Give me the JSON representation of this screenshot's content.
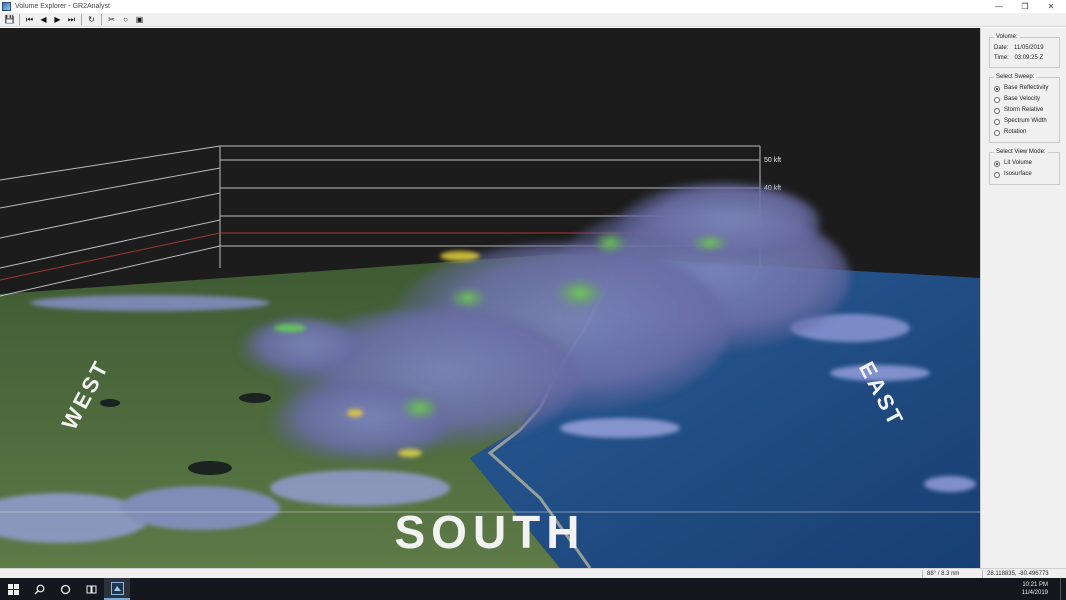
{
  "window": {
    "title": "Volume Explorer - GR2Analyst",
    "controls": {
      "minimize": "—",
      "restore": "❐",
      "close": "✕"
    }
  },
  "toolbar": {
    "buttons": [
      {
        "name": "save-icon",
        "glyph": "💾"
      },
      {
        "name": "first-frame-icon",
        "glyph": "⏮"
      },
      {
        "name": "prev-frame-icon",
        "glyph": "◀"
      },
      {
        "name": "play-icon",
        "glyph": "▶"
      },
      {
        "name": "last-frame-icon",
        "glyph": "⏭"
      },
      {
        "name": "refresh-icon",
        "glyph": "↻"
      },
      {
        "name": "cut-icon",
        "glyph": "✂"
      },
      {
        "name": "circle-icon",
        "glyph": "○"
      },
      {
        "name": "screenshot-icon",
        "glyph": "▣"
      }
    ]
  },
  "view": {
    "height_labels": [
      "50 kft",
      "40 kft"
    ],
    "directions": {
      "west": "WEST",
      "south": "SOUTH",
      "east": "EAST"
    }
  },
  "panel": {
    "volume": {
      "legend": "Volume:",
      "date_label": "Date:",
      "date_value": "11/05/2019",
      "time_label": "Time:",
      "time_value": "03:09:25 Z"
    },
    "sweep": {
      "legend": "Select Sweep:",
      "options": [
        "Base Reflectivity",
        "Base Velocity",
        "Storm Relative",
        "Spectrum Width",
        "Rotation"
      ],
      "selected": 0
    },
    "view_mode": {
      "legend": "Select View Mode:",
      "options": [
        "Lit Volume",
        "Isosurface"
      ],
      "selected": 0
    }
  },
  "status": {
    "angle_range": "88° / 8.3 nm",
    "coordinates": "28.118835, -80.496773"
  },
  "taskbar": {
    "time": "10:21 PM",
    "date": "11/4/2019"
  },
  "colors": {
    "background": "#1c1c1c",
    "land": "#4b6a3c",
    "ocean": "#1f4f8a",
    "precip": "#8f91d6",
    "storm": "#6e73a8",
    "reflectivity_high": "#5fcf4a",
    "reflectivity_peak": "#f2e63a"
  }
}
